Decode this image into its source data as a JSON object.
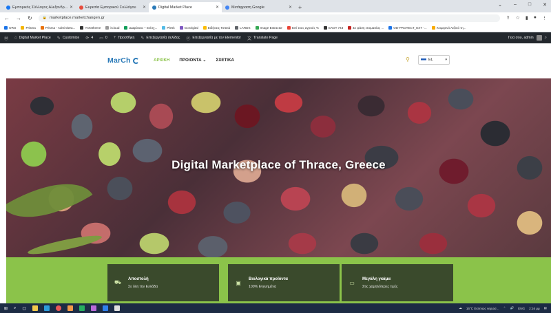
{
  "browser": {
    "tabs": [
      {
        "label": "Εμπορικός Σύλλογος Αλεξανδρ...",
        "color": "#1877f2",
        "active": false
      },
      {
        "label": "Ευρεσία Εμπορικού Συλλόγου",
        "color": "#e74c3c",
        "active": false
      },
      {
        "label": "Digital Market Place",
        "color": "#2a7ab8",
        "active": true
      },
      {
        "label": "Μετάφραση Google",
        "color": "#4285f4",
        "active": false
      }
    ],
    "new_tab": "+",
    "url": "marketplace.marketchangen.gr",
    "bookmarks": [
      {
        "label": "ORG",
        "color": "#1a73e8"
      },
      {
        "label": "Prisma",
        "color": "#f4b400"
      },
      {
        "label": "Prisma - Administra...",
        "color": "#e8710a"
      },
      {
        "label": "YOOtheme",
        "color": "#333333"
      },
      {
        "label": "iCloud",
        "color": "#999999"
      },
      {
        "label": "Διαφάνεια – Ενίσχ...",
        "color": "#0f9d58"
      },
      {
        "label": "Plesk",
        "color": "#52bbe6"
      },
      {
        "label": "Go Digital",
        "color": "#7e57c2"
      },
      {
        "label": "Ειδήσεις Τοπικά",
        "color": "#fbbc04"
      },
      {
        "label": "LARDS",
        "color": "#5f6368"
      },
      {
        "label": "Image Extractor",
        "color": "#34a853"
      },
      {
        "label": "Επί τους αγρούς %",
        "color": "#ea4335"
      },
      {
        "label": "ΕΛΟΤ 743",
        "color": "#333333"
      },
      {
        "label": "Σε φάση ετοιμασίας ...",
        "color": "#c5221f"
      },
      {
        "label": "OD-PROTECT_EXT -...",
        "color": "#1a73e8"
      },
      {
        "label": "Χειμερινό Λεξικό τη...",
        "color": "#f9ab00"
      }
    ]
  },
  "admin_bar": {
    "items": [
      "Digital Market Place",
      "Customize",
      "4",
      "0",
      "Προσθήκη",
      "Επεξεργασία σελίδας",
      "Επεξεργασία με τον Elementor",
      "Translate Page"
    ],
    "greeting": "Γεια σου, admin"
  },
  "header": {
    "logo": "MarCh",
    "nav": [
      "ΑΡΧΙΚΗ",
      "ΠΡΟΙΟΝΤΑ",
      "ΣΧΕΤΙΚΑ"
    ],
    "language": "EL"
  },
  "hero": {
    "title": "Digital Marketplace of Thrace, Greece"
  },
  "features": [
    {
      "title": "Αποστολή",
      "subtitle": "Σε όλη την Ελλάδα",
      "icon": "truck-icon"
    },
    {
      "title": "Βιολογικά προϊόντα",
      "subtitle": "100% Εγγυημένα",
      "icon": "certificate-icon"
    },
    {
      "title": "Μεγάλη γκάμα",
      "subtitle": "Στις χαμηλότερες τιμές",
      "icon": "money-icon"
    }
  ],
  "taskbar": {
    "weather": "16°C Εκτενώς νεφώσ...",
    "lang": "ENG",
    "time": "2:16 μμ"
  },
  "colors": {
    "brand_green": "#8bc34a",
    "card_dark": "#3a4a2c",
    "admin_bar": "#23282d",
    "logo_blue": "#2a7ab8"
  }
}
